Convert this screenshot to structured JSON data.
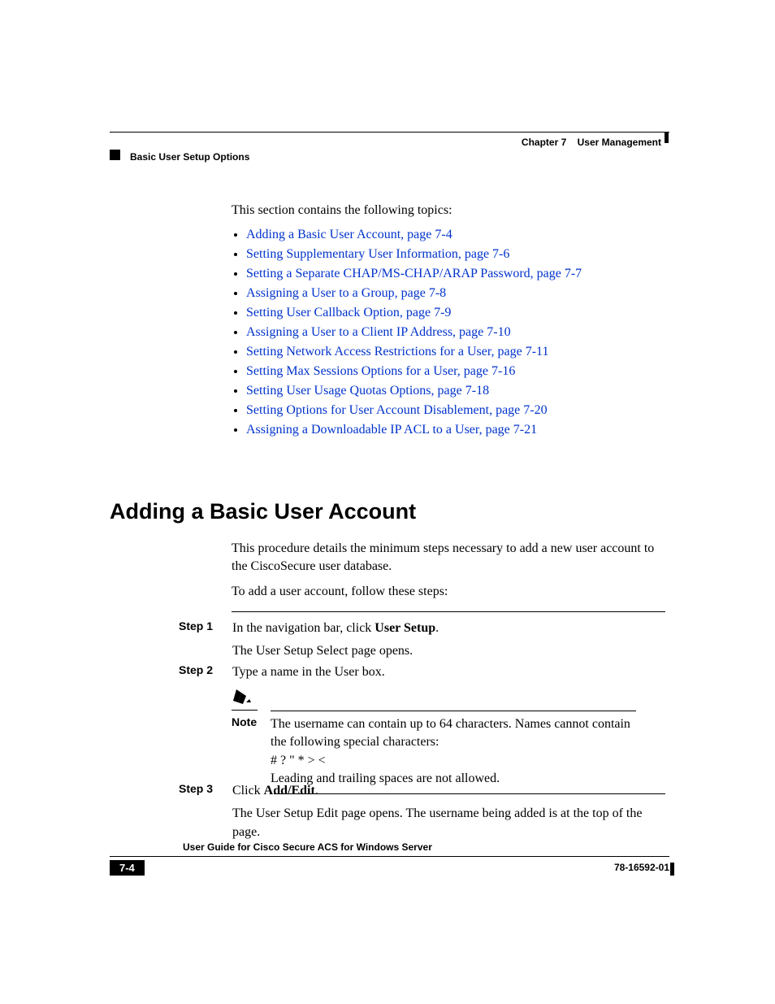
{
  "header": {
    "chapter_label": "Chapter 7",
    "chapter_title": "User Management",
    "section_title": "Basic User Setup Options"
  },
  "intro": "This section contains the following topics:",
  "topics": [
    "Adding a Basic User Account, page 7-4",
    "Setting Supplementary User Information, page 7-6",
    "Setting a Separate CHAP/MS-CHAP/ARAP Password, page 7-7",
    "Assigning a User to a Group, page 7-8",
    "Setting User Callback Option, page 7-9",
    "Assigning a User to a Client IP Address, page 7-10",
    "Setting Network Access Restrictions for a User, page 7-11",
    "Setting Max Sessions Options for a User, page 7-16",
    "Setting User Usage Quotas Options, page 7-18",
    "Setting Options for User Account Disablement, page 7-20",
    "Assigning a Downloadable IP ACL to a User, page 7-21"
  ],
  "heading2": "Adding a Basic User Account",
  "section_intro": [
    "This procedure details the minimum steps necessary to add a new user account to the CiscoSecure user database.",
    "To add a user account, follow these steps:"
  ],
  "steps": {
    "step1": {
      "label": "Step 1",
      "line1_pre": "In the navigation bar, click ",
      "line1_bold": "User Setup",
      "line1_post": ".",
      "line2": "The User Setup Select page opens."
    },
    "step2": {
      "label": "Step 2",
      "line1": "Type a name in the User box."
    },
    "note": {
      "label": "Note",
      "text1": "The username can contain up to 64 characters. Names cannot contain the following special characters:",
      "chars": " # ? \" * > <",
      "text2": "Leading and trailing spaces are not allowed."
    },
    "step3": {
      "label": "Step 3",
      "line1_pre": "Click ",
      "line1_bold": "Add/Edit",
      "line1_post": ".",
      "line2": "The User Setup Edit page opens. The username being added is at the top of the page."
    }
  },
  "footer": {
    "guide_title": "User Guide for Cisco Secure ACS for Windows Server",
    "page_num": "7-4",
    "doc_id": "78-16592-01"
  }
}
